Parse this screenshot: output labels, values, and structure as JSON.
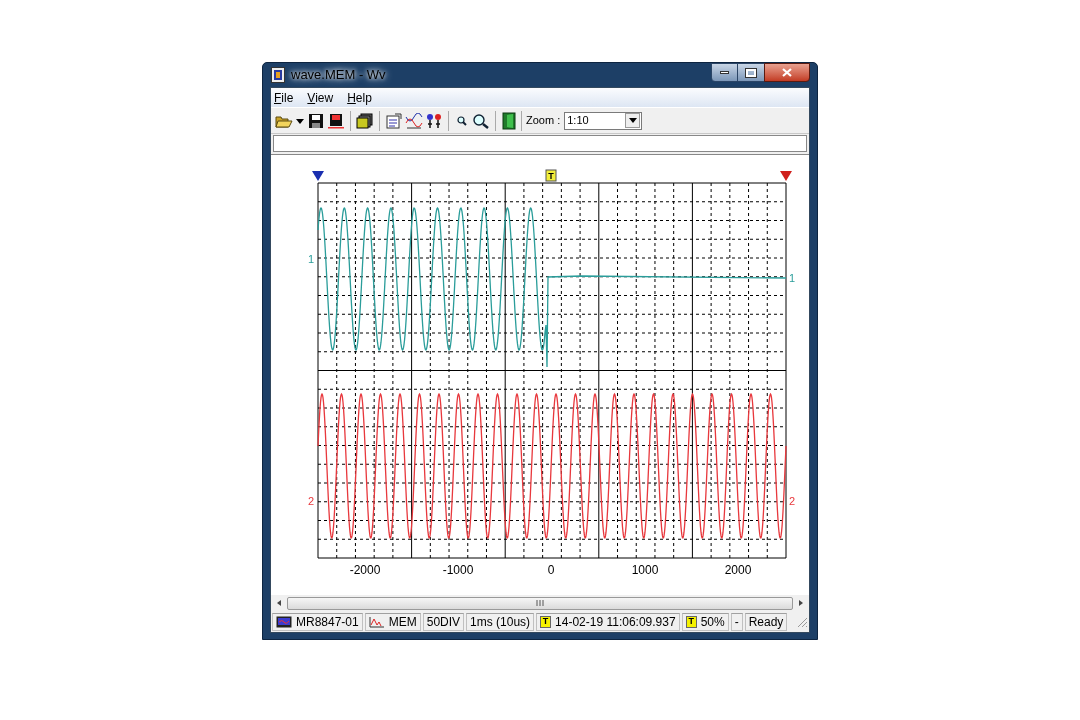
{
  "window": {
    "title": "wave.MEM - Wv"
  },
  "menu": [
    "File",
    "View",
    "Help"
  ],
  "toolbar": {
    "zoom_label": "Zoom :",
    "zoom_value": "1:10"
  },
  "chart": {
    "trigger_marker": "T",
    "x_tick_labels": [
      "-2000",
      "-1000",
      "0",
      "1000",
      "2000"
    ],
    "channels": [
      {
        "left_label": "1",
        "right_label": "1",
        "color": "#2a9d9a"
      },
      {
        "left_label": "2",
        "right_label": "2",
        "color": "#e8383d"
      }
    ]
  },
  "status_bar": [
    {
      "kind": "device",
      "text": "MR8847-01"
    },
    {
      "kind": "mem",
      "text": "MEM"
    },
    {
      "kind": "plain",
      "text": "50DIV"
    },
    {
      "kind": "plain",
      "text": "1ms (10us)"
    },
    {
      "kind": "trigger",
      "badge": "T",
      "text": "14-02-19 11:06:09.937"
    },
    {
      "kind": "trigger_pos",
      "badge": "T",
      "text": "50%"
    },
    {
      "kind": "plain",
      "text": "-"
    },
    {
      "kind": "plain",
      "text": "Ready"
    }
  ]
}
